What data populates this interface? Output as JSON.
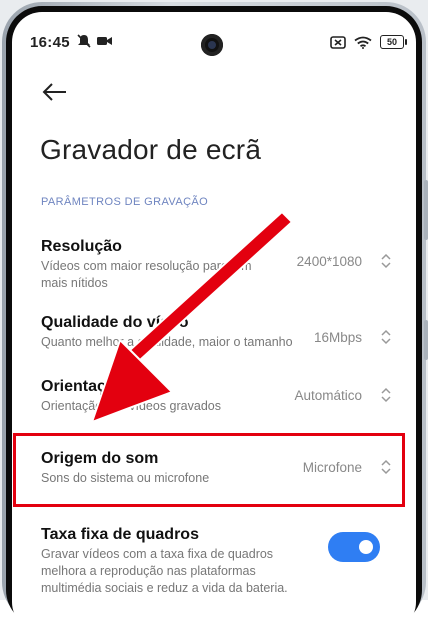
{
  "status_bar": {
    "time": "16:45",
    "battery": "50"
  },
  "page": {
    "title": "Gravador de ecrã",
    "section_header": "PARÂMETROS DE GRAVAÇÃO"
  },
  "settings": [
    {
      "title": "Resolução",
      "subtitle": "Vídeos com maior resolução parecem mais nítidos",
      "value": "2400*1080"
    },
    {
      "title": "Qualidade do vídeo",
      "subtitle": "Quanto melhor a qualidade, maior o tamanho",
      "value": "16Mbps"
    },
    {
      "title": "Orientação",
      "subtitle": "Orientação dos vídeos gravados",
      "value": "Automático"
    },
    {
      "title": "Origem do som",
      "subtitle": "Sons do sistema ou microfone",
      "value": "Microfone"
    }
  ],
  "fixed_frame_rate": {
    "title": "Taxa fixa de quadros",
    "subtitle": "Gravar vídeos com a taxa fixa de quadros melhora a reprodução nas plataformas multimédia sociais e reduz a vida da bateria.",
    "enabled": true
  },
  "colors": {
    "accent": "#2f7ef3",
    "highlight": "#e3000f",
    "section_header": "#6f85c0"
  }
}
